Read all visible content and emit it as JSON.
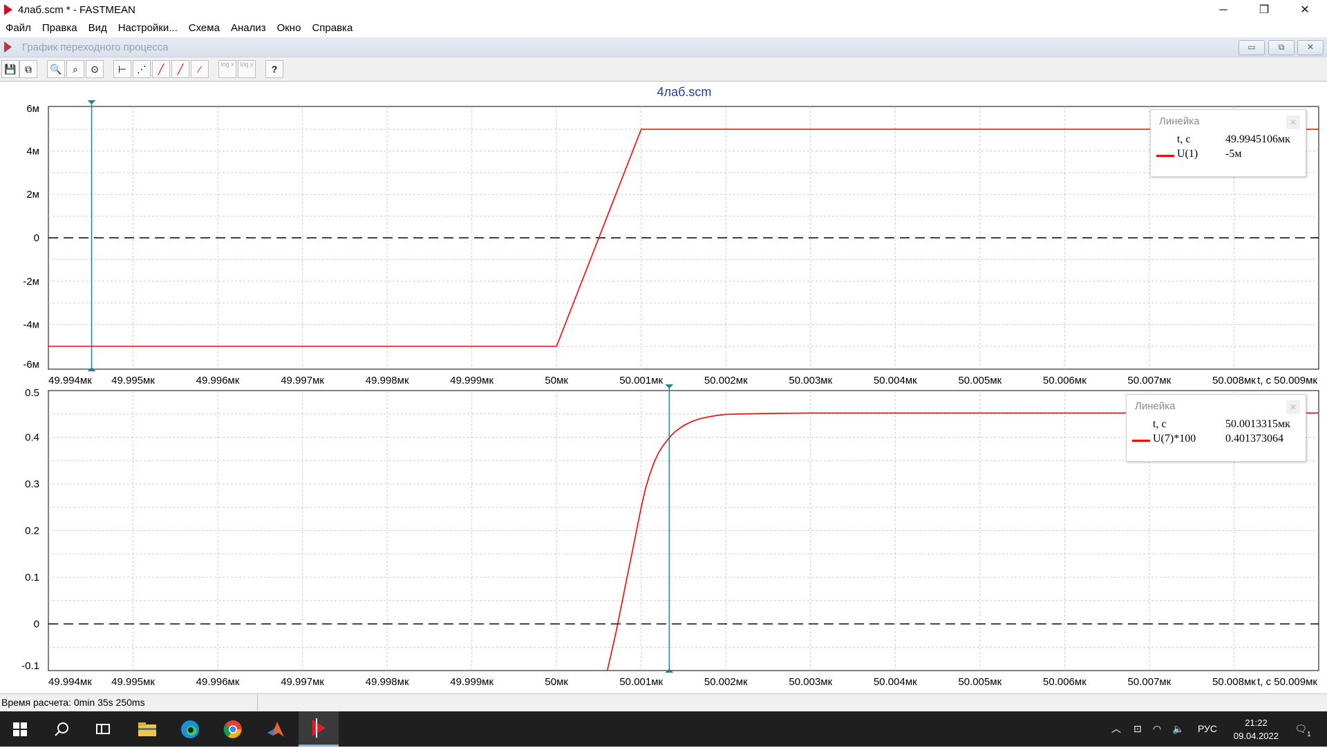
{
  "window": {
    "title": "4лаб.scm * - FASTMEAN",
    "minimize": "─",
    "maximize": "❐",
    "close": "✕"
  },
  "menu": [
    "Файл",
    "Правка",
    "Вид",
    "Настройки...",
    "Схема",
    "Анализ",
    "Окно",
    "Справка"
  ],
  "child_window": {
    "caption": "График переходного процесса",
    "minimize": "▭",
    "restore": "⧉",
    "close": "✕"
  },
  "toolbar": {
    "buttons": [
      {
        "name": "save-icon",
        "glyph": "💾"
      },
      {
        "name": "copy-icon",
        "glyph": "⧉"
      },
      {
        "name": "zoom-icon",
        "glyph": "🔍"
      },
      {
        "name": "zoom-area-icon",
        "glyph": "⌕"
      },
      {
        "name": "zoom-reset-icon",
        "glyph": "⊙"
      },
      {
        "name": "ruler-icon",
        "glyph": "⊢"
      },
      {
        "name": "line-dot-icon",
        "glyph": "⋰"
      },
      {
        "name": "line-icon",
        "glyph": "╱"
      },
      {
        "name": "line-bold-icon",
        "glyph": "╱"
      },
      {
        "name": "line-dotted-icon",
        "glyph": "⁄"
      },
      {
        "name": "log-x-icon",
        "glyph": "log x"
      },
      {
        "name": "log-y-icon",
        "glyph": "log y"
      },
      {
        "name": "help-icon",
        "glyph": "?"
      }
    ]
  },
  "colors": {
    "trace": "#ff0000",
    "cursor": "#2e7d8f",
    "grid": "#c8c8c8",
    "zero": "#000000",
    "title": "#1f3fa8"
  },
  "chart_data": [
    {
      "type": "line",
      "title": "4лаб.scm",
      "xlabel": "t, c",
      "x_ticks": [
        "49.994мк",
        "49.995мк",
        "49.996мк",
        "49.997мк",
        "49.998мк",
        "49.999мк",
        "50мк",
        "50.001мк",
        "50.002мк",
        "50.003мк",
        "50.004мк",
        "50.005мк",
        "50.006мк",
        "50.007мк",
        "50.008мк",
        "50.009мк"
      ],
      "x_tick_values": [
        49.994,
        49.995,
        49.996,
        49.997,
        49.998,
        49.999,
        50.0,
        50.001,
        50.002,
        50.003,
        50.004,
        50.005,
        50.006,
        50.007,
        50.008,
        50.009
      ],
      "xlim": [
        49.994,
        50.009
      ],
      "y_ticks": [
        "6м",
        "4м",
        "2м",
        "0",
        "-2м",
        "-4м",
        "-6м"
      ],
      "y_tick_values": [
        6,
        4,
        2,
        0,
        -2,
        -4,
        -6
      ],
      "ylim": [
        -6.05,
        6.05
      ],
      "y_unit": "м",
      "series": [
        {
          "name": "U(1)",
          "x": [
            49.994,
            49.999,
            50.0,
            50.001,
            50.009
          ],
          "y": [
            -5,
            -5,
            -5,
            5,
            5
          ]
        }
      ],
      "cursor_x": 49.9945106,
      "legend": {
        "title": "Линейка",
        "rows": [
          {
            "key": "t, c",
            "value": "49.9945106мк"
          },
          {
            "key": "U(1)",
            "value": "-5м"
          }
        ]
      }
    },
    {
      "type": "line",
      "xlabel": "t, c",
      "x_ticks": [
        "49.994мк",
        "49.995мк",
        "49.996мк",
        "49.997мк",
        "49.998мк",
        "49.999мк",
        "50мк",
        "50.001мк",
        "50.002мк",
        "50.003мк",
        "50.004мк",
        "50.005мк",
        "50.006мк",
        "50.007мк",
        "50.008мк",
        "50.009мк"
      ],
      "x_tick_values": [
        49.994,
        49.995,
        49.996,
        49.997,
        49.998,
        49.999,
        50.0,
        50.001,
        50.002,
        50.003,
        50.004,
        50.005,
        50.006,
        50.007,
        50.008,
        50.009
      ],
      "xlim": [
        49.994,
        50.009
      ],
      "y_ticks": [
        "0.5",
        "0.4",
        "0.3",
        "0.2",
        "0.1",
        "0",
        "-0.1"
      ],
      "y_tick_values": [
        0.5,
        0.4,
        0.3,
        0.2,
        0.1,
        0,
        -0.1
      ],
      "ylim": [
        -0.1,
        0.5
      ],
      "series": [
        {
          "name": "U(7)*100",
          "x": [
            50.0006,
            50.0007,
            50.0008,
            50.0009,
            50.001,
            50.00105,
            50.0011,
            50.00115,
            50.0012,
            50.00125,
            50.0013,
            50.00135,
            50.0014,
            50.0015,
            50.0016,
            50.0017,
            50.0018,
            50.0019,
            50.002,
            50.0022,
            50.0025,
            50.003,
            50.009
          ],
          "y": [
            -0.1,
            -0.02,
            0.07,
            0.16,
            0.25,
            0.29,
            0.32,
            0.345,
            0.365,
            0.38,
            0.392,
            0.403,
            0.412,
            0.425,
            0.434,
            0.44,
            0.444,
            0.447,
            0.449,
            0.45,
            0.451,
            0.452,
            0.452
          ]
        }
      ],
      "cursor_x": 50.0013315,
      "legend": {
        "title": "Линейка",
        "rows": [
          {
            "key": "t, c",
            "value": "50.0013315мк"
          },
          {
            "key": "U(7)*100",
            "value": "0.401373064"
          }
        ]
      }
    }
  ],
  "status": {
    "calc_time": "Время расчета: 0min 35s 250ms"
  },
  "taskbar": {
    "apps": [
      {
        "name": "start-icon"
      },
      {
        "name": "search-icon"
      },
      {
        "name": "task-view-icon"
      },
      {
        "name": "file-explorer-icon"
      },
      {
        "name": "edge-icon"
      },
      {
        "name": "chrome-icon"
      },
      {
        "name": "matlab-icon"
      },
      {
        "name": "fastmean-icon",
        "active": true
      }
    ],
    "language": "РУС",
    "time": "21:22",
    "date": "09.04.2022",
    "notifications": "1"
  }
}
